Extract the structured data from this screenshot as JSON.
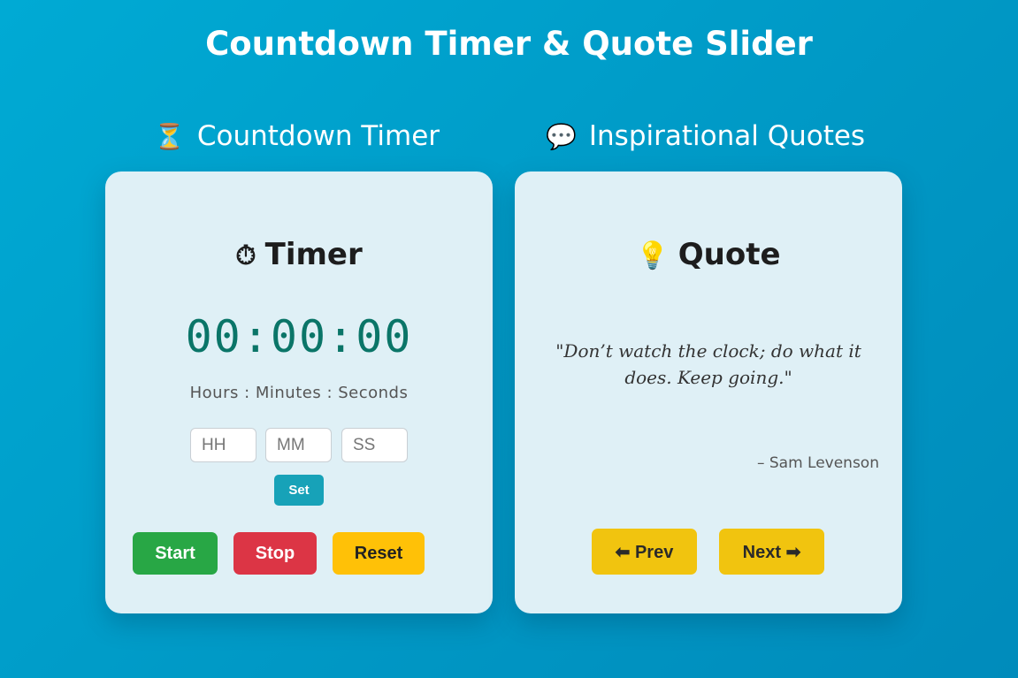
{
  "page": {
    "title": "Countdown Timer & Quote Slider"
  },
  "timer_section": {
    "heading_icon": "⏳",
    "heading_label": "Countdown Timer",
    "card": {
      "title_icon": "⏱",
      "title": "Timer",
      "display": "00:00:00",
      "units_label": "Hours : Minutes : Seconds",
      "inputs": {
        "hours_placeholder": "HH",
        "minutes_placeholder": "MM",
        "seconds_placeholder": "SS",
        "hours_value": "",
        "minutes_value": "",
        "seconds_value": ""
      },
      "set_label": "Set",
      "start_label": "Start",
      "stop_label": "Stop",
      "reset_label": "Reset"
    }
  },
  "quotes_section": {
    "heading_icon": "💬",
    "heading_label": "Inspirational Quotes",
    "card": {
      "title_icon": "💡",
      "title": "Quote",
      "quote_text": "\"Don’t watch the clock; do what it does. Keep going.\"",
      "quote_author": "– Sam Levenson",
      "prev_label": "⬅ Prev",
      "next_label": "Next ➡"
    }
  },
  "colors": {
    "background": "#00a3cc",
    "card_background": "#dff0f6",
    "timer_digits": "#0a7568",
    "start": "#28a745",
    "stop": "#dc3545",
    "reset": "#ffc107",
    "set": "#17a2b8",
    "nav_buttons": "#f1c40f"
  }
}
